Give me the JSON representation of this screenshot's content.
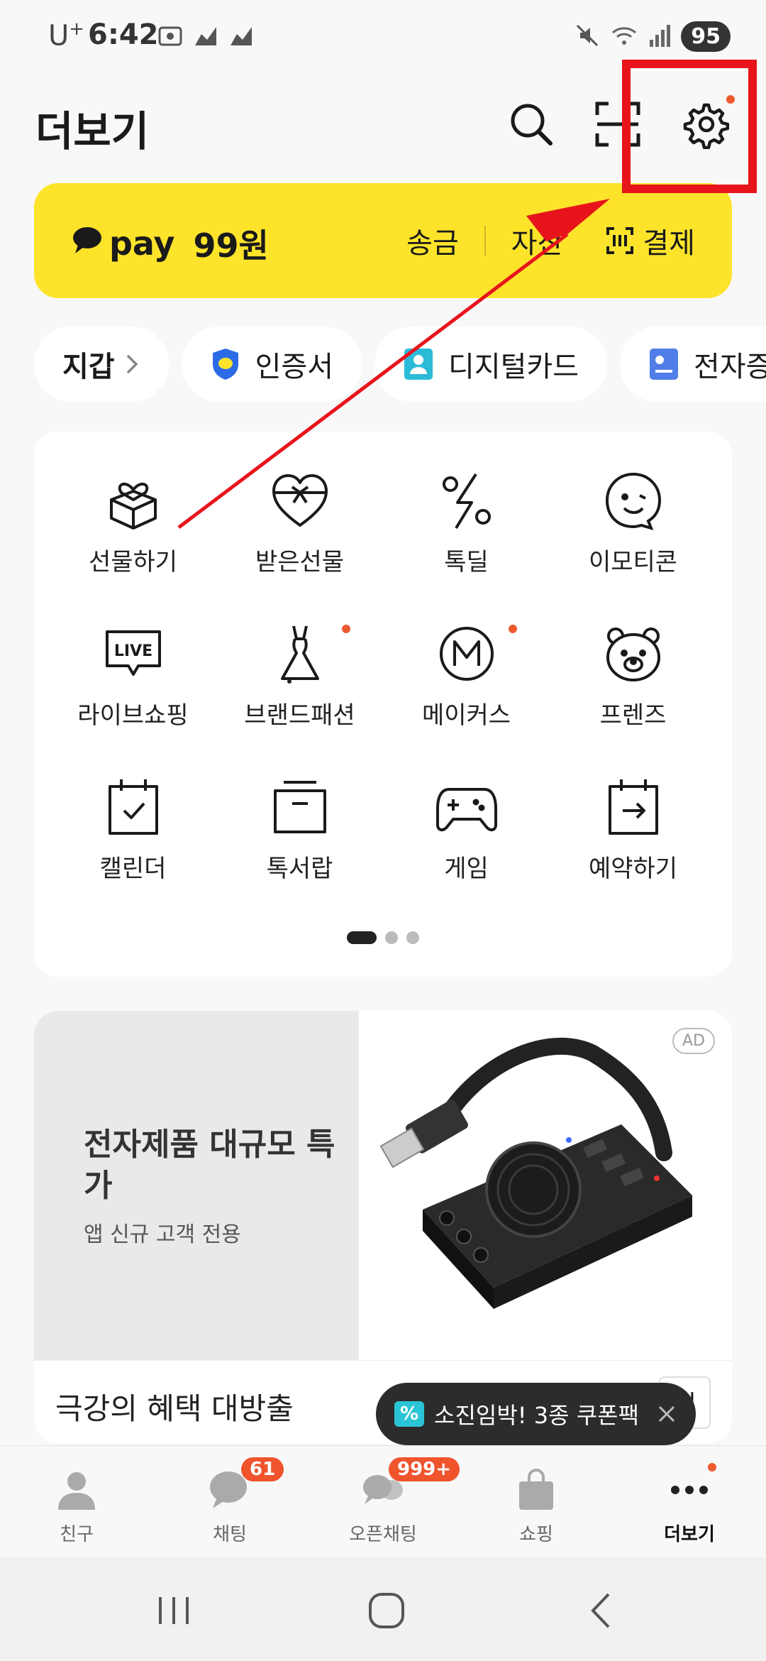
{
  "status_bar": {
    "carrier": "U",
    "carrier_sup": "+",
    "time": "6:42",
    "battery": "95"
  },
  "header": {
    "title": "더보기"
  },
  "pay_banner": {
    "brand": "pay",
    "amount": "99원",
    "actions": [
      "송금",
      "자산",
      "결제"
    ]
  },
  "chips": [
    {
      "label": "지갑"
    },
    {
      "label": "인증서"
    },
    {
      "label": "디지털카드"
    },
    {
      "label": "전자증"
    }
  ],
  "menu": [
    {
      "label": "선물하기",
      "icon": "gift-box-icon",
      "dot": false
    },
    {
      "label": "받은선물",
      "icon": "gift-heart-icon",
      "dot": false
    },
    {
      "label": "톡딜",
      "icon": "percent-bolt-icon",
      "dot": false
    },
    {
      "label": "이모티콘",
      "icon": "emoticon-icon",
      "dot": false
    },
    {
      "label": "라이브쇼핑",
      "icon": "live-icon",
      "dot": false
    },
    {
      "label": "브랜드패션",
      "icon": "dress-icon",
      "dot": true
    },
    {
      "label": "메이커스",
      "icon": "makers-icon",
      "dot": true
    },
    {
      "label": "프렌즈",
      "icon": "bear-icon",
      "dot": false
    },
    {
      "label": "캘린더",
      "icon": "calendar-check-icon",
      "dot": false
    },
    {
      "label": "톡서랍",
      "icon": "drawer-icon",
      "dot": false
    },
    {
      "label": "게임",
      "icon": "gamepad-icon",
      "dot": false
    },
    {
      "label": "예약하기",
      "icon": "calendar-arrow-icon",
      "dot": false
    }
  ],
  "ad": {
    "headline": "전자제품 대규모 특가",
    "sub": "앱 신규 고객 전용",
    "badge": "AD",
    "footer_title": "극강의 혜택 대방출",
    "footer_button": "기"
  },
  "toast": {
    "icon": "%",
    "text": "소진임박! 3종 쿠폰팩"
  },
  "tabs": [
    {
      "label": "친구",
      "icon": "person-icon"
    },
    {
      "label": "채팅",
      "icon": "chat-icon",
      "count": "61"
    },
    {
      "label": "오픈채팅",
      "icon": "open-chat-icon",
      "count": "999+"
    },
    {
      "label": "쇼핑",
      "icon": "shopping-bag-icon"
    },
    {
      "label": "더보기",
      "icon": "more-dots-icon",
      "active": true
    }
  ],
  "colors": {
    "pay_yellow": "#fde42b",
    "badge_orange": "#f0542d",
    "annotation_red": "#e8141c"
  }
}
